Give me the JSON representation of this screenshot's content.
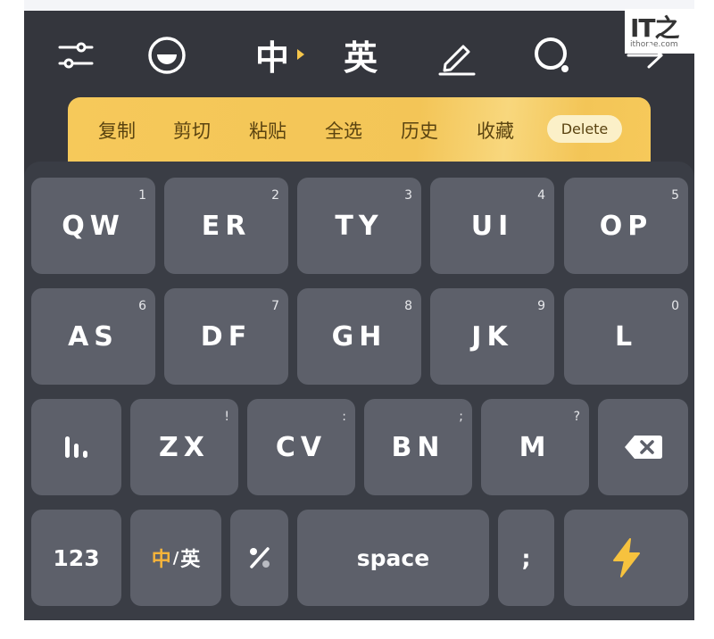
{
  "toolbar": {
    "settings_icon": "sliders-icon",
    "emoji_icon": "smiley-icon",
    "zh_label": "中",
    "en_label": "英",
    "handwrite_icon": "pencil-icon",
    "search_icon": "search-icon",
    "next_icon": "arrow-right-icon"
  },
  "clipboard": {
    "items": [
      "复制",
      "剪切",
      "粘贴",
      "全选",
      "历史",
      "收藏"
    ],
    "delete_label": "Delete"
  },
  "rows": {
    "row1": [
      {
        "label": "QW",
        "num": "1"
      },
      {
        "label": "ER",
        "num": "2"
      },
      {
        "label": "TY",
        "num": "3"
      },
      {
        "label": "UI",
        "num": "4"
      },
      {
        "label": "OP",
        "num": "5"
      }
    ],
    "row2": [
      {
        "label": "AS",
        "num": "6"
      },
      {
        "label": "DF",
        "num": "7"
      },
      {
        "label": "GH",
        "num": "8"
      },
      {
        "label": "JK",
        "num": "9"
      },
      {
        "label": "L",
        "num": "0"
      }
    ],
    "row3": [
      {
        "label": "ZX",
        "num": "!"
      },
      {
        "label": "CV",
        "num": ":"
      },
      {
        "label": "BN",
        "num": ";"
      },
      {
        "label": "M",
        "num": "?"
      }
    ]
  },
  "bottom": {
    "num_label": "123",
    "zh": "中",
    "slash": "/",
    "en": "英",
    "space_label": "space",
    "semicolon": ";"
  },
  "watermark": {
    "logo": "IT之",
    "site": "ithome.com"
  },
  "colors": {
    "keyboard_bg": "#34363d",
    "key_bg": "#5d606a",
    "clipboard_bg": "#f3c557",
    "accent_yellow": "#f6b43a"
  }
}
